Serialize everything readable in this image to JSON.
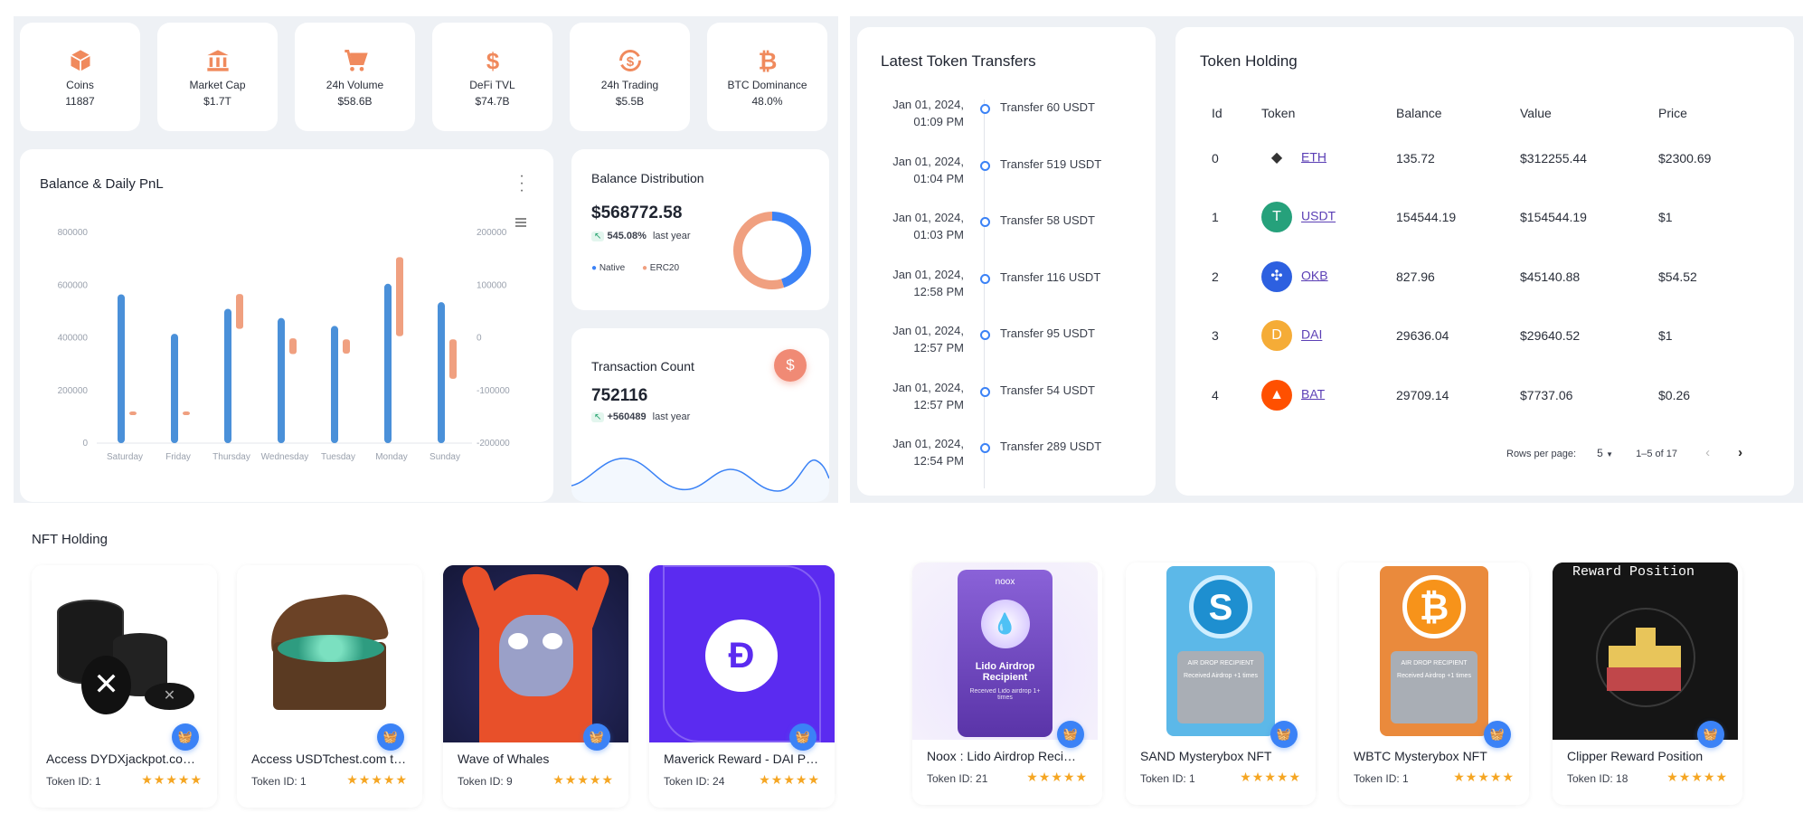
{
  "stats": [
    {
      "icon": "cube-icon",
      "label": "Coins",
      "value": "11887"
    },
    {
      "icon": "bank-icon",
      "label": "Market Cap",
      "value": "$1.7T"
    },
    {
      "icon": "cart-icon",
      "label": "24h Volume",
      "value": "$58.6B"
    },
    {
      "icon": "dollar-icon",
      "label": "DeFi TVL",
      "value": "$74.7B"
    },
    {
      "icon": "exchange-icon",
      "label": "24h Trading",
      "value": "$5.5B"
    },
    {
      "icon": "bitcoin-icon",
      "label": "BTC Dominance",
      "value": "48.0%"
    }
  ],
  "accent": "#3b82f6",
  "orange": "#f0a080",
  "balance_chart": {
    "title": "Balance & Daily PnL",
    "chart_data": {
      "type": "bar",
      "categories": [
        "Saturday",
        "Friday",
        "Thursday",
        "Wednesday",
        "Tuesday",
        "Monday",
        "Sunday"
      ],
      "left_axis": {
        "ticks": [
          "800000",
          "600000",
          "400000",
          "200000",
          "0"
        ],
        "ylim": [
          0,
          800000
        ]
      },
      "right_axis": {
        "ticks": [
          "200000",
          "100000",
          "0",
          "-100000",
          "-200000"
        ],
        "ylim": [
          -200000,
          200000
        ]
      },
      "series": [
        {
          "color": "#4a90d9",
          "values": [
            [
              0,
              565000
            ],
            [
              0,
              415000
            ],
            [
              0,
              510000
            ],
            [
              0,
              475000
            ],
            [
              0,
              445000
            ],
            [
              0,
              605000
            ],
            [
              0,
              535000
            ]
          ]
        },
        {
          "color": "#f0a080",
          "values": [
            [
              0,
              -140000
            ],
            [
              0,
              -140000
            ],
            [
              17000,
              83000
            ],
            [
              -31000,
              -1000
            ],
            [
              -30000,
              -3000
            ],
            [
              3000,
              153000
            ],
            [
              -78000,
              -3000
            ]
          ]
        }
      ]
    }
  },
  "distribution": {
    "title": "Balance Distribution",
    "value": "$568772.58",
    "pct": "545.08%",
    "pct_label": "last year",
    "legend": [
      "Native",
      "ERC20"
    ],
    "chart_data": {
      "type": "pie",
      "slices": [
        {
          "name": "Native",
          "value": 45
        },
        {
          "name": "ERC20",
          "value": 55
        }
      ]
    }
  },
  "tx_count": {
    "title": "Transaction Count",
    "value": "752116",
    "delta": "+560489",
    "delta_label": "last year"
  },
  "transfers": {
    "title": "Latest Token Transfers",
    "items": [
      {
        "date": "Jan 01, 2024,",
        "time": "01:09 PM",
        "text": "Transfer 60 USDT"
      },
      {
        "date": "Jan 01, 2024,",
        "time": "01:04 PM",
        "text": "Transfer 519 USDT"
      },
      {
        "date": "Jan 01, 2024,",
        "time": "01:03 PM",
        "text": "Transfer 58 USDT"
      },
      {
        "date": "Jan 01, 2024,",
        "time": "12:58 PM",
        "text": "Transfer 116 USDT"
      },
      {
        "date": "Jan 01, 2024,",
        "time": "12:57 PM",
        "text": "Transfer 95 USDT"
      },
      {
        "date": "Jan 01, 2024,",
        "time": "12:57 PM",
        "text": "Transfer 54 USDT"
      },
      {
        "date": "Jan 01, 2024,",
        "time": "12:54 PM",
        "text": "Transfer 289 USDT"
      }
    ]
  },
  "holding": {
    "title": "Token Holding",
    "columns": [
      "Id",
      "Token",
      "Balance",
      "Value",
      "Price"
    ],
    "rows": [
      {
        "id": "0",
        "token": "ETH",
        "icon": "eth-icon",
        "color": "#ffffff",
        "balance": "135.72",
        "value": "$312255.44",
        "price": "$2300.69"
      },
      {
        "id": "1",
        "token": "USDT",
        "icon": "tether-icon",
        "color": "#26a17b",
        "balance": "154544.19",
        "value": "$154544.19",
        "price": "$1"
      },
      {
        "id": "2",
        "token": "OKB",
        "icon": "okb-icon",
        "color": "#2d60e0",
        "balance": "827.96",
        "value": "$45140.88",
        "price": "$54.52"
      },
      {
        "id": "3",
        "token": "DAI",
        "icon": "dai-icon",
        "color": "#f5ac37",
        "balance": "29636.04",
        "value": "$29640.52",
        "price": "$1"
      },
      {
        "id": "4",
        "token": "BAT",
        "icon": "bat-icon",
        "color": "#ff5000",
        "balance": "29709.14",
        "value": "$7737.06",
        "price": "$0.26"
      }
    ],
    "rows_per_page_label": "Rows per page:",
    "rows_per_page": "5",
    "range": "1–5 of 17"
  },
  "nft": {
    "title": "NFT Holding",
    "items": [
      {
        "name": "Access DYDXjackpot.com - Claim",
        "tid": "Token ID: 1",
        "bg": "#ffffff"
      },
      {
        "name": "Access USDTchest.com to claim",
        "tid": "Token ID: 1",
        "bg": "#ffffff"
      },
      {
        "name": "Wave of Whales",
        "tid": "Token ID: 9",
        "bg": "#1b1d4a"
      },
      {
        "name": "Maverick Reward - DAI Position",
        "tid": "Token ID: 24",
        "bg": "#5b2bf0"
      },
      {
        "name": "Noox : Lido Airdrop Recipient",
        "tid": "Token ID: 21",
        "bg": "#f1ecfb"
      },
      {
        "name": "SAND Mysterybox NFT",
        "tid": "Token ID: 1",
        "bg": "#ffffff"
      },
      {
        "name": "WBTC Mysterybox NFT",
        "tid": "Token ID: 1",
        "bg": "#ffffff"
      },
      {
        "name": "Clipper Reward Position",
        "tid": "Token ID: 18",
        "bg": "#151515"
      }
    ],
    "stars": "★★★★★",
    "nft_texts": {
      "noox": "noox",
      "lido_title": "Lido Airdrop Recipient",
      "lido_sub": "Received Lido airdrop 1+ times",
      "airdrop": "AIR DROP RECIPIENT",
      "sand_sub": "Received Airdrop +1 times",
      "clipper": "Reward Position"
    }
  }
}
